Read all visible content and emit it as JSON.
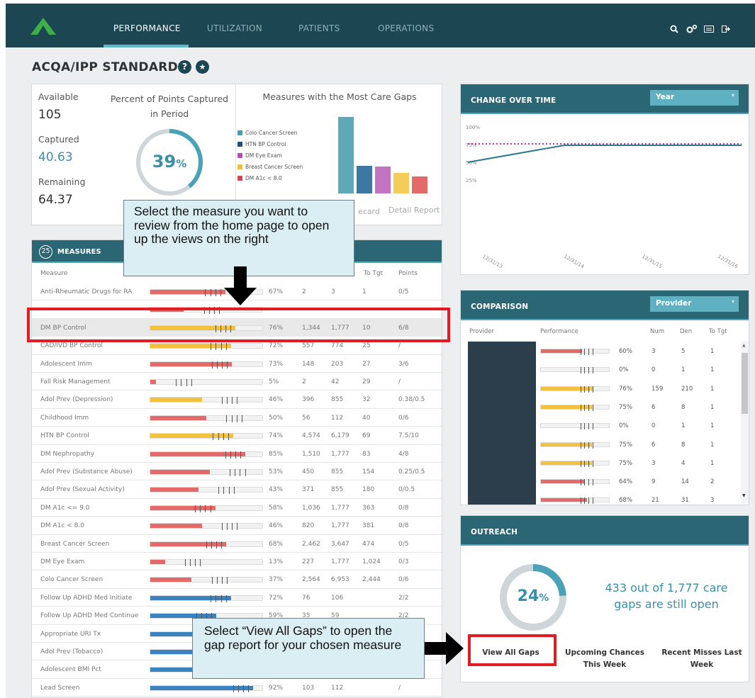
{
  "nav": {
    "tabs": [
      "PERFORMANCE",
      "UTILIZATION",
      "PATIENTS",
      "OPERATIONS"
    ],
    "active": 0,
    "icons": [
      "search-icon",
      "settings-icon",
      "message-icon",
      "logout-icon"
    ]
  },
  "page": {
    "title": "ACQA/IPP STANDARD",
    "icons": [
      "help-icon",
      "star-icon"
    ]
  },
  "summary": {
    "available_label": "Available",
    "available": "105",
    "captured_label": "Captured",
    "captured": "40.63",
    "remaining_label": "Remaining",
    "remaining": "64.37",
    "percent_title": "Percent of Points Captured in Period",
    "percent": "39",
    "percent_value": 0.39,
    "percent_unit": "%",
    "gaps_title": "Measures with the Most Care Gaps",
    "gaps_legend": [
      {
        "name": "Colo Cancer Screen",
        "color": "#4a9bab"
      },
      {
        "name": "HTN BP Control",
        "color": "#1f4e79"
      },
      {
        "name": "DM Eye Exam",
        "color": "#b94ab0"
      },
      {
        "name": "Breast Cancer Screen",
        "color": "#f2c02c"
      },
      {
        "name": "DM A1c < 8.0",
        "color": "#d9434f"
      }
    ],
    "gaps_bars": [
      {
        "color": "#5ea8b8",
        "value": 1.0
      },
      {
        "color": "#3d78a3",
        "value": 0.36
      },
      {
        "color": "#c274c0",
        "value": 0.35
      },
      {
        "color": "#f4cc58",
        "value": 0.27
      },
      {
        "color": "#e46a6a",
        "value": 0.22
      }
    ],
    "scorecard_link": "ecard",
    "detail_link": "Detail Report"
  },
  "measures": {
    "count": "25",
    "title": "MEASURES",
    "columns": [
      "Measure",
      "To Tgt",
      "Points"
    ],
    "rows": [
      {
        "name": "Anti-Rheumatic Drugs for RA",
        "color": "#e46a6a",
        "fill": 0.67,
        "pct": "67%",
        "num": "2",
        "den": "3",
        "tgt": "1",
        "pts": "0/5"
      },
      {
        "name": "",
        "color": "#e46a6a",
        "fill": 0.3,
        "pct": "",
        "num": "",
        "den": "",
        "tgt": "",
        "pts": ""
      },
      {
        "name": "DM BP Control",
        "color": "#f2c23c",
        "fill": 0.76,
        "pct": "76%",
        "num": "1,344",
        "den": "1,777",
        "tgt": "10",
        "pts": "6/8"
      },
      {
        "name": "CAD/IVD BP Control",
        "color": "#f2c23c",
        "fill": 0.72,
        "pct": "72%",
        "num": "557",
        "den": "774",
        "tgt": "25",
        "pts": "/"
      },
      {
        "name": "Adolescent Imm",
        "color": "#e46a6a",
        "fill": 0.73,
        "pct": "73%",
        "num": "148",
        "den": "203",
        "tgt": "27",
        "pts": "3/6"
      },
      {
        "name": "Fall Risk Management",
        "color": "#e46a6a",
        "fill": 0.05,
        "pct": "5%",
        "num": "2",
        "den": "42",
        "tgt": "29",
        "pts": "/"
      },
      {
        "name": "Adol Prev (Depression)",
        "color": "#f2c23c",
        "fill": 0.46,
        "pct": "46%",
        "num": "396",
        "den": "855",
        "tgt": "32",
        "pts": "0.38/0.5"
      },
      {
        "name": "Childhood Imm",
        "color": "#e46a6a",
        "fill": 0.5,
        "pct": "50%",
        "num": "56",
        "den": "112",
        "tgt": "40",
        "pts": "0/6"
      },
      {
        "name": "HTN BP Control",
        "color": "#f2c23c",
        "fill": 0.74,
        "pct": "74%",
        "num": "4,574",
        "den": "6,179",
        "tgt": "69",
        "pts": "7.5/10"
      },
      {
        "name": "DM Nephropathy",
        "color": "#e46a6a",
        "fill": 0.85,
        "pct": "85%",
        "num": "1,510",
        "den": "1,777",
        "tgt": "83",
        "pts": "4/8"
      },
      {
        "name": "Adol Prev (Substance Abuse)",
        "color": "#e46a6a",
        "fill": 0.53,
        "pct": "53%",
        "num": "450",
        "den": "855",
        "tgt": "154",
        "pts": "0.25/0.5"
      },
      {
        "name": "Adol Prev (Sexual Activity)",
        "color": "#e46a6a",
        "fill": 0.43,
        "pct": "43%",
        "num": "371",
        "den": "855",
        "tgt": "180",
        "pts": "0/0.5"
      },
      {
        "name": "DM A1c <= 9.0",
        "color": "#e46a6a",
        "fill": 0.58,
        "pct": "58%",
        "num": "1,036",
        "den": "1,777",
        "tgt": "363",
        "pts": "0/8"
      },
      {
        "name": "DM A1c < 8.0",
        "color": "#e46a6a",
        "fill": 0.46,
        "pct": "46%",
        "num": "820",
        "den": "1,777",
        "tgt": "381",
        "pts": "0/8"
      },
      {
        "name": "Breast Cancer Screen",
        "color": "#e46a6a",
        "fill": 0.68,
        "pct": "68%",
        "num": "2,462",
        "den": "3,647",
        "tgt": "474",
        "pts": "0/5"
      },
      {
        "name": "DM Eye Exam",
        "color": "#e46a6a",
        "fill": 0.13,
        "pct": "13%",
        "num": "227",
        "den": "1,777",
        "tgt": "1,024",
        "pts": "0/3"
      },
      {
        "name": "Colo Cancer Screen",
        "color": "#e46a6a",
        "fill": 0.37,
        "pct": "37%",
        "num": "2,564",
        "den": "6,953",
        "tgt": "2,444",
        "pts": "0/6"
      },
      {
        "name": "Follow Up ADHD Med Initiate",
        "color": "#3a83c0",
        "fill": 0.72,
        "pct": "72%",
        "num": "76",
        "den": "106",
        "tgt": "",
        "pts": "2/2"
      },
      {
        "name": "Follow Up ADHD Med Continue",
        "color": "#3a83c0",
        "fill": 0.59,
        "pct": "59%",
        "num": "35",
        "den": "59",
        "tgt": "",
        "pts": "2/2"
      },
      {
        "name": "Appropriate URI Tx",
        "color": "#3a83c0",
        "fill": 0.55,
        "pct": "",
        "num": "",
        "den": "",
        "tgt": "",
        "pts": ""
      },
      {
        "name": "Adol Prev (Tobacco)",
        "color": "#3a83c0",
        "fill": 0.55,
        "pct": "",
        "num": "",
        "den": "",
        "tgt": "",
        "pts": ""
      },
      {
        "name": "Adolescent BMI Pct",
        "color": "#3a83c0",
        "fill": 0.55,
        "pct": "",
        "num": "",
        "den": "",
        "tgt": "",
        "pts": ""
      },
      {
        "name": "Lead Screen",
        "color": "#3a83c0",
        "fill": 0.92,
        "pct": "92%",
        "num": "103",
        "den": "112",
        "tgt": "",
        "pts": "/"
      }
    ]
  },
  "change_over_time": {
    "title": "CHANGE OVER TIME",
    "dropdown": "Year",
    "y_ticks": [
      "100%",
      "75%",
      "50%",
      "25%"
    ],
    "x_ticks": [
      "12/31/13",
      "12/31/14",
      "12/31/15",
      "12/31/16"
    ]
  },
  "chart_data": {
    "type": "line",
    "x": [
      "12/31/13",
      "12/31/14",
      "12/31/15",
      "12/31/16"
    ],
    "ylim": [
      0,
      100
    ],
    "series": [
      {
        "values": [
          50,
          74,
          74,
          74
        ],
        "color": "#2a7a8c",
        "style": "solid"
      },
      {
        "values": [
          76,
          76,
          76,
          76
        ],
        "color": "#c2409b",
        "style": "dotted"
      }
    ]
  },
  "comparison": {
    "title": "COMPARISON",
    "dropdown": "Provider",
    "columns": [
      "Provider",
      "Performance",
      "Num",
      "Den",
      "To Tgt"
    ],
    "rows": [
      {
        "color": "#e46a6a",
        "fill": 0.6,
        "pct": "60%",
        "num": "3",
        "den": "5",
        "tgt": "1"
      },
      {
        "color": "#e46a6a",
        "fill": 0.0,
        "pct": "0%",
        "num": "0",
        "den": "1",
        "tgt": "1"
      },
      {
        "color": "#f2c23c",
        "fill": 0.76,
        "pct": "76%",
        "num": "159",
        "den": "210",
        "tgt": "1"
      },
      {
        "color": "#f2c23c",
        "fill": 0.75,
        "pct": "75%",
        "num": "6",
        "den": "8",
        "tgt": "1"
      },
      {
        "color": "#f2c23c",
        "fill": 0.0,
        "pct": "0%",
        "num": "0",
        "den": "1",
        "tgt": "1"
      },
      {
        "color": "#f2c23c",
        "fill": 0.75,
        "pct": "75%",
        "num": "6",
        "den": "8",
        "tgt": "1"
      },
      {
        "color": "#f2c23c",
        "fill": 0.75,
        "pct": "75%",
        "num": "3",
        "den": "4",
        "tgt": "1"
      },
      {
        "color": "#e46a6a",
        "fill": 0.64,
        "pct": "64%",
        "num": "9",
        "den": "14",
        "tgt": "2"
      },
      {
        "color": "#e46a6a",
        "fill": 0.68,
        "pct": "68%",
        "num": "21",
        "den": "31",
        "tgt": "3"
      }
    ]
  },
  "outreach": {
    "title": "OUTREACH",
    "percent": "24",
    "percent_value": 0.24,
    "percent_unit": "%",
    "message": "433 out of 1,777 care gaps are still open",
    "view_all": "View All Gaps",
    "upcoming": "Upcoming Chances This Week",
    "recent": "Recent Misses Last Week"
  },
  "annotations": {
    "callout1": "Select the measure you want to review from the home page to open up the views on the right",
    "callout2": "Select “View All Gaps” to open the gap report for your chosen measure"
  }
}
